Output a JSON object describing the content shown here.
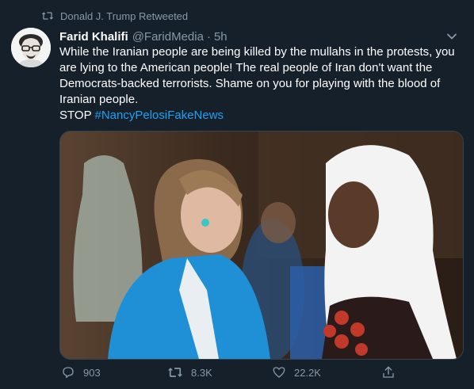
{
  "retweet_context": {
    "icon": "retweet-icon",
    "text": "Donald J. Trump Retweeted"
  },
  "tweet": {
    "author_name": "Farid Khalifi",
    "author_handle": "@FaridMedia",
    "separator": "·",
    "time": "5h",
    "menu_icon": "chevron-down-icon",
    "text_line1": "While the Iranian people are being killed by the mullahs in the protests, you are lying to the American people! The real people of Iran don't want the Democrats-backed terrorists. Shame on you for playing with the blood of Iranian people.",
    "text_prefix": "STOP",
    "hashtag": "#NancyPelosiFakeNews"
  },
  "actions": {
    "reply_count": "903",
    "retweet_count": "8.3K",
    "like_count": "22.2K",
    "reply_icon": "reply-icon",
    "retweet_icon": "retweet-icon",
    "like_icon": "heart-icon",
    "share_icon": "share-icon"
  },
  "colors": {
    "background": "#15202b",
    "muted_text": "#8899a6",
    "link": "#1da1f2",
    "border": "#38444d"
  }
}
